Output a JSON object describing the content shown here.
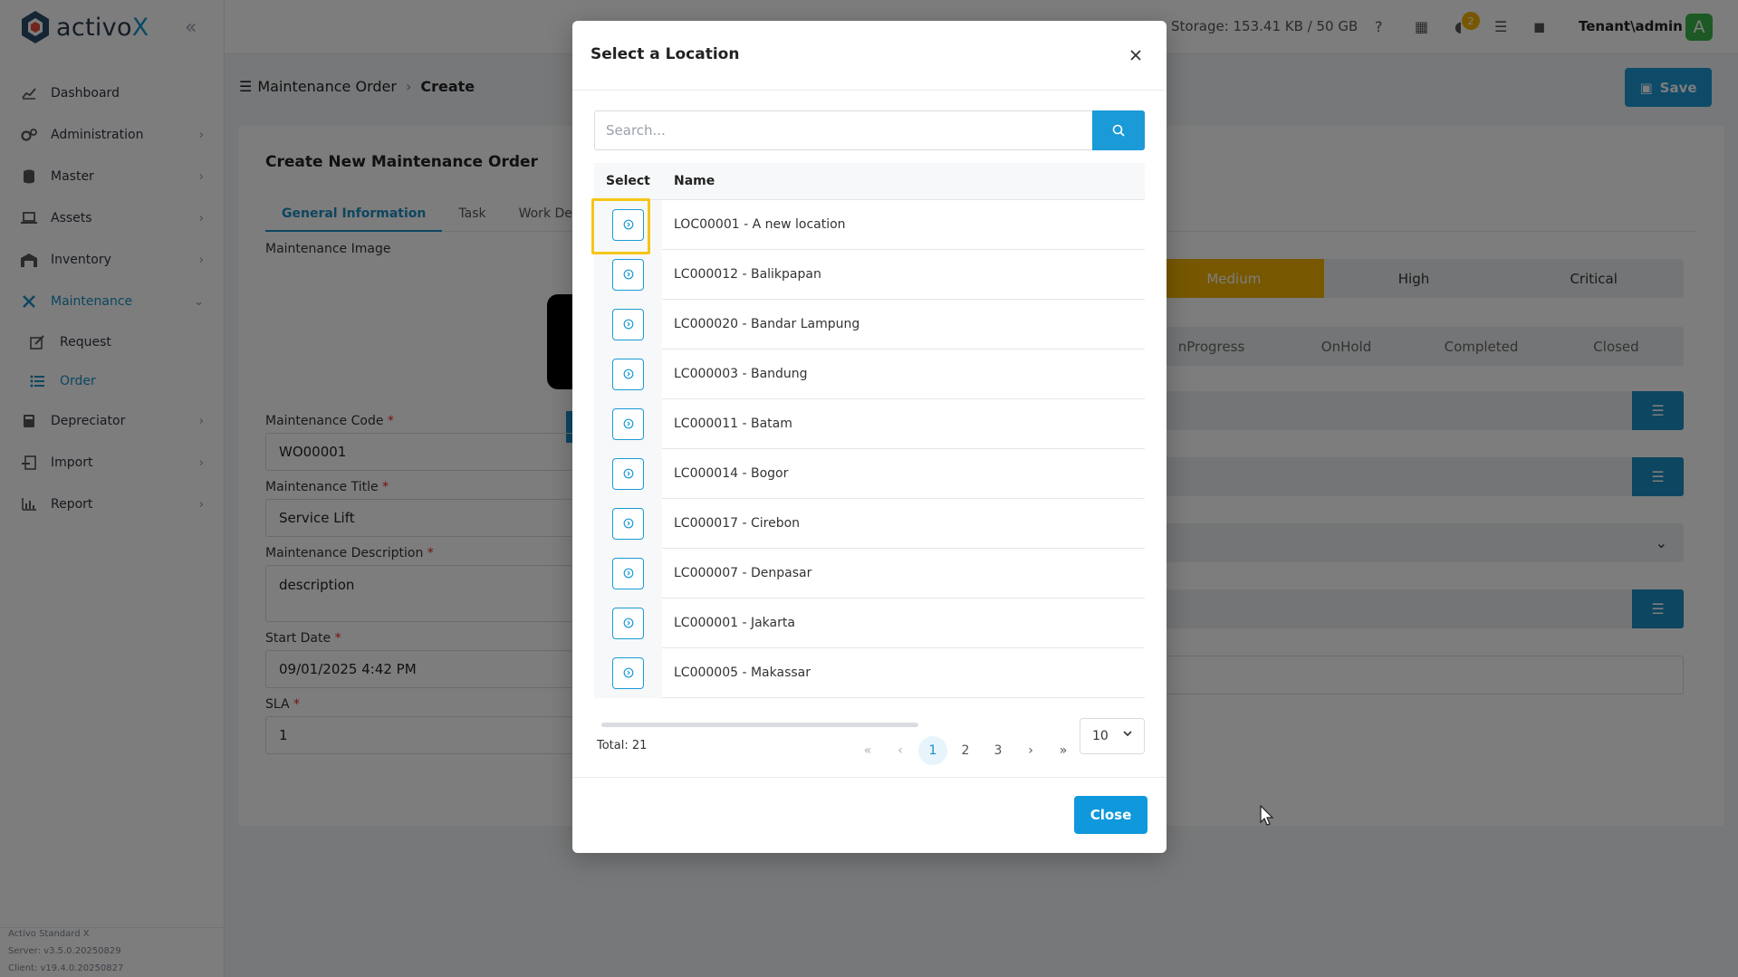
{
  "app": {
    "logo_text_a": "activo",
    "logo_text_b": "X",
    "colors": {
      "accent": "#1a9ad6",
      "highlight": "#f5c518",
      "priority_selected": "#f2b400",
      "avatar": "#39b54a"
    }
  },
  "sidebar": {
    "items": [
      {
        "label": "Dashboard",
        "icon": "chart-line-icon"
      },
      {
        "label": "Administration",
        "icon": "gears-icon"
      },
      {
        "label": "Master",
        "icon": "database-icon"
      },
      {
        "label": "Assets",
        "icon": "laptop-icon"
      },
      {
        "label": "Inventory",
        "icon": "warehouse-icon"
      },
      {
        "label": "Maintenance",
        "icon": "tools-icon"
      },
      {
        "label": "Depreciator",
        "icon": "calculator-icon"
      },
      {
        "label": "Import",
        "icon": "file-import-icon"
      },
      {
        "label": "Report",
        "icon": "chart-bar-icon"
      }
    ],
    "sub_items": [
      {
        "label": "Request",
        "icon": "edit-icon"
      },
      {
        "label": "Order",
        "icon": "list-icon"
      }
    ],
    "footer": {
      "product": "Activo Standard X",
      "server": "Server: v3.5.0.20250829",
      "client": "Client: v19.4.0.20250827"
    }
  },
  "topbar": {
    "storage": "Storage: 153.41 KB / 50 GB",
    "notification_count": "2",
    "user": "Tenant\\admin",
    "avatar_letter": "A"
  },
  "page": {
    "breadcrumb_parent": "Maintenance Order",
    "breadcrumb_current": "Create",
    "save_label": "Save",
    "card_title": "Create New Maintenance Order",
    "tabs": [
      "General Information",
      "Task",
      "Work Detail"
    ],
    "image_label": "Maintenance Image",
    "fields": {
      "code_label": "Maintenance Code",
      "code_value": "WO00001",
      "title_label": "Maintenance Title",
      "title_value": "Service Lift",
      "desc_label": "Maintenance Description",
      "desc_value": "description",
      "start_label": "Start Date",
      "start_value": "09/01/2025 4:42 PM",
      "sla_label": "SLA",
      "sla_value": "1"
    },
    "priority": [
      "Medium",
      "High",
      "Critical"
    ],
    "status": [
      "nProgress",
      "OnHold",
      "Completed",
      "Closed"
    ]
  },
  "modal": {
    "title": "Select a Location",
    "search_placeholder": "Search...",
    "col_select": "Select",
    "col_name": "Name",
    "rows": [
      "LOC00001 - A new location",
      "LC000012 - Balikpapan",
      "LC000020 - Bandar Lampung",
      "LC000003 - Bandung",
      "LC000011 - Batam",
      "LC000014 - Bogor",
      "LC000017 - Cirebon",
      "LC000007 - Denpasar",
      "LC000001 - Jakarta",
      "LC000005 - Makassar"
    ],
    "total": "Total: 21",
    "pages": [
      "1",
      "2",
      "3"
    ],
    "page_size": "10",
    "close_label": "Close"
  }
}
